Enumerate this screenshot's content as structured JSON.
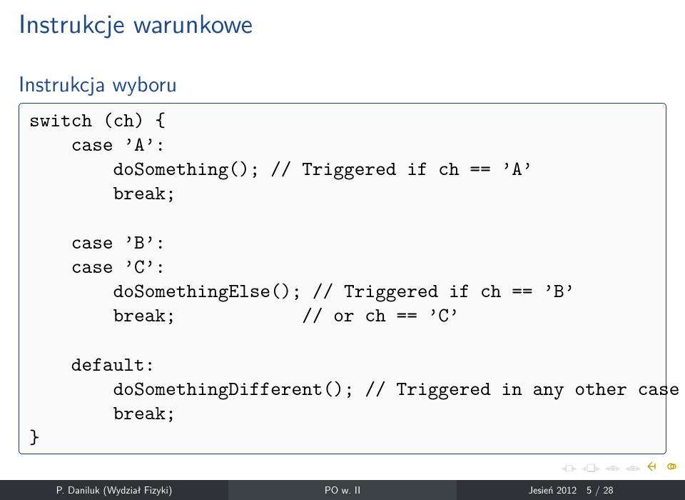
{
  "title": "Instrukcje warunkowe",
  "subtitle": "Instrukcja wyboru",
  "code_lines": [
    "switch (ch) {",
    "    case 'A':",
    "        doSomething(); // Triggered if ch == 'A'",
    "        break;",
    "",
    "    case 'B':",
    "    case 'C':",
    "        doSomethingElse(); // Triggered if ch == 'B'",
    "        break;            // or ch == 'C'",
    "",
    "    default:",
    "        doSomethingDifferent(); // Triggered in any other case",
    "        break;",
    "}"
  ],
  "nav_glyph_left": "◂",
  "nav_glyph_right": "▸",
  "nav_glyph_pages": "❏",
  "nav_glyph_bar1": "≡",
  "nav_glyph_bar2": "≡",
  "footer": {
    "author": "P. Daniluk (Wydział Fizyki)",
    "center": "PO w. II",
    "term": "Jesień 2012",
    "page": "5 / 28"
  }
}
